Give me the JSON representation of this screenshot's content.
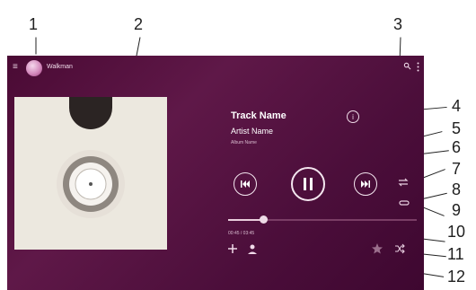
{
  "app": {
    "title": "Walkman"
  },
  "track": {
    "name": "Track Name",
    "artist": "Artist Name",
    "album": "Album Name"
  },
  "player": {
    "progress_percent": 19,
    "time_text": "00:45 / 03:45"
  },
  "labels": [
    "1",
    "2",
    "3",
    "4",
    "5",
    "6",
    "7",
    "8",
    "9",
    "10",
    "11",
    "12"
  ],
  "icons": [
    "menu-icon",
    "walkman-avatar-icon",
    "search-icon",
    "more-vertical-icon",
    "info-icon",
    "previous-icon",
    "pause-icon",
    "next-icon",
    "repeat-icon",
    "shuffle-icon",
    "add-icon",
    "person-icon",
    "star-icon"
  ]
}
